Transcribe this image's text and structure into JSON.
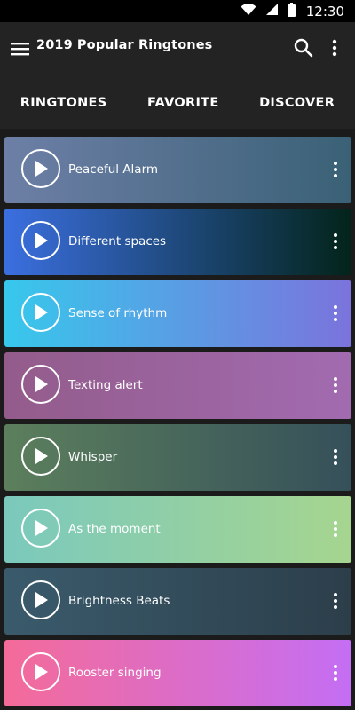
{
  "status_bar": {
    "time": "12:30",
    "icons": [
      "wifi-icon",
      "cell-signal-icon",
      "battery-icon"
    ]
  },
  "app_bar": {
    "title": "2019 Popular Ringtones",
    "icons": [
      "menu-icon",
      "search-icon",
      "more-vert-icon"
    ]
  },
  "tabs": [
    {
      "label": "RINGTONES"
    },
    {
      "label": "FAVORITE"
    },
    {
      "label": "DISCOVER"
    }
  ],
  "ringtones": [
    {
      "title": "Peaceful Alarm",
      "gradient": [
        "#6d7fa6",
        "#3a6176"
      ]
    },
    {
      "title": "Different spaces",
      "gradient": [
        "#3b6fe0",
        "#03241a"
      ]
    },
    {
      "title": "Sense of rhythm",
      "gradient": [
        "#37c8ec",
        "#7b73dc"
      ]
    },
    {
      "title": "Texting alert",
      "gradient": [
        "#935c8b",
        "#a26bb0"
      ]
    },
    {
      "title": "Whisper",
      "gradient": [
        "#5c7f5c",
        "#35505a"
      ]
    },
    {
      "title": "As the moment",
      "gradient": [
        "#7bc9bd",
        "#a6d58f"
      ]
    },
    {
      "title": "Brightness Beats",
      "gradient": [
        "#3a5b6c",
        "#2c3e4a"
      ]
    },
    {
      "title": "Rooster singing",
      "gradient": [
        "#f46b99",
        "#c46ef4"
      ]
    }
  ]
}
